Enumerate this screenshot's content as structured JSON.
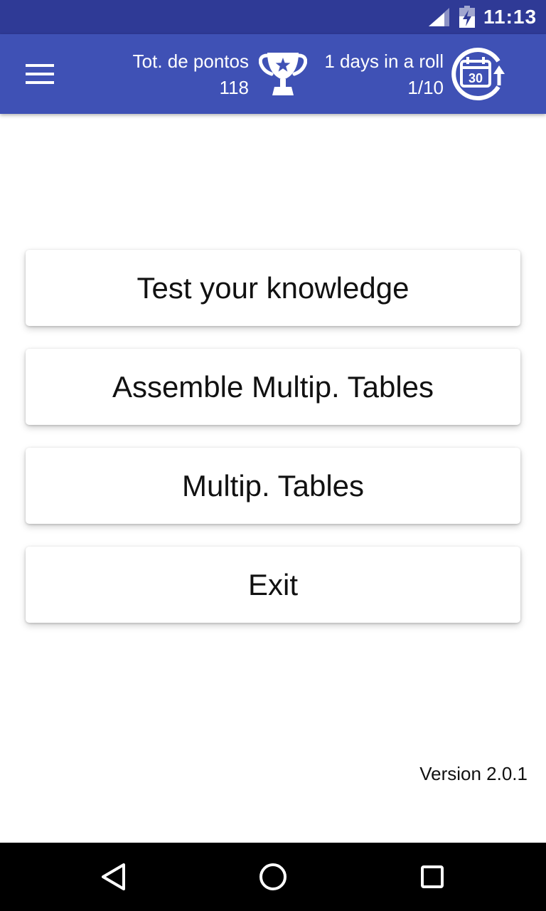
{
  "status_bar": {
    "time": "11:13",
    "icons": [
      "signal-icon",
      "battery-charging-icon"
    ]
  },
  "app_bar": {
    "menu_icon": "hamburger-menu-icon",
    "points_label": "Tot. de pontos",
    "points_value": "118",
    "trophy_icon": "trophy-icon",
    "streak_label": "1 days in a roll",
    "streak_value": "1/10",
    "calendar_icon": "calendar-30-icon",
    "calendar_day": "30"
  },
  "menu": {
    "items": [
      {
        "label": "Test your knowledge"
      },
      {
        "label": "Assemble Multip. Tables"
      },
      {
        "label": "Multip. Tables"
      },
      {
        "label": "Exit"
      }
    ]
  },
  "footer": {
    "version": "Version 2.0.1"
  },
  "nav_bar": {
    "icons": [
      "back-icon",
      "home-icon",
      "recents-icon"
    ]
  },
  "colors": {
    "status_bar": "#2f3a96",
    "app_bar": "#3f51b5",
    "background": "#ffffff",
    "nav_bar": "#000000"
  }
}
